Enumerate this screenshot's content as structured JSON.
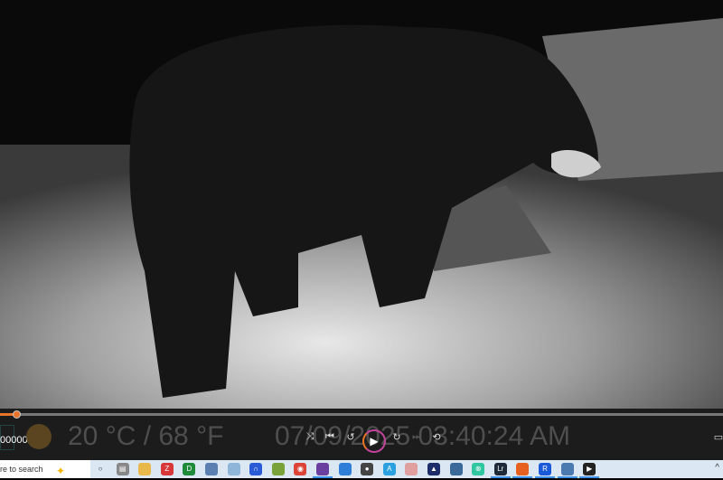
{
  "video": {
    "overlay_temperature": "20 °C / 68 °F",
    "overlay_datetime": "07/09/2025 03:40:24 AM",
    "progress_percent": 2.3,
    "frame_counter": "000000",
    "accent": "#e8742a"
  },
  "controls": [
    {
      "name": "shuffle-icon",
      "glyph": "⤨"
    },
    {
      "name": "previous-icon",
      "glyph": "⏮"
    },
    {
      "name": "rewind-icon",
      "glyph": "↺"
    },
    {
      "name": "play-icon",
      "glyph": "▶"
    },
    {
      "name": "forward-icon",
      "glyph": "↻"
    },
    {
      "name": "next-icon",
      "glyph": "⏭"
    },
    {
      "name": "repeat-off-icon",
      "glyph": "⟲"
    }
  ],
  "taskbar": {
    "search_placeholder": "re to search",
    "icons": [
      {
        "name": "cortana-icon",
        "color": "transparent",
        "glyph": "○"
      },
      {
        "name": "task-view-icon",
        "color": "#888",
        "glyph": "▤"
      },
      {
        "name": "file-explorer-icon",
        "color": "#e9b84a",
        "glyph": ""
      },
      {
        "name": "app-red-icon",
        "color": "#d9383a",
        "glyph": "Z"
      },
      {
        "name": "shield-app-icon",
        "color": "#1e8a3a",
        "glyph": "D"
      },
      {
        "name": "app-photo-icon",
        "color": "#5a7fb0",
        "glyph": ""
      },
      {
        "name": "app-blue-icon",
        "color": "#8fb5d8",
        "glyph": ""
      },
      {
        "name": "headphones-app-icon",
        "color": "#2a5bd7",
        "glyph": "∩"
      },
      {
        "name": "stack-app-icon",
        "color": "#7aa23a",
        "glyph": ""
      },
      {
        "name": "chrome-icon",
        "color": "#db4437",
        "glyph": "◉"
      },
      {
        "name": "app-purple-icon",
        "color": "#6b3fa0",
        "glyph": ""
      },
      {
        "name": "app-blue2-icon",
        "color": "#2f7fd9",
        "glyph": ""
      },
      {
        "name": "app-camera-icon",
        "color": "#444",
        "glyph": "●"
      },
      {
        "name": "app-cyan-icon",
        "color": "#2aa0e0",
        "glyph": "A"
      },
      {
        "name": "app-cloud-icon",
        "color": "#e0a0a0",
        "glyph": ""
      },
      {
        "name": "app-triangle-icon",
        "color": "#1d2d6a",
        "glyph": "▲"
      },
      {
        "name": "app-globe-icon",
        "color": "#3a6a9a",
        "glyph": ""
      },
      {
        "name": "app-green-icon",
        "color": "#2fc6a0",
        "glyph": "⊗"
      },
      {
        "name": "lightroom-icon",
        "color": "#1e2a3a",
        "glyph": "Lr"
      },
      {
        "name": "firefox-icon",
        "color": "#e66020",
        "glyph": ""
      },
      {
        "name": "app-r-icon",
        "color": "#1a5ad8",
        "glyph": "R"
      },
      {
        "name": "app-screen-icon",
        "color": "#4a7ab0",
        "glyph": ""
      },
      {
        "name": "media-player-icon",
        "color": "#222",
        "glyph": "▶"
      }
    ],
    "tray_chevron": "^"
  }
}
